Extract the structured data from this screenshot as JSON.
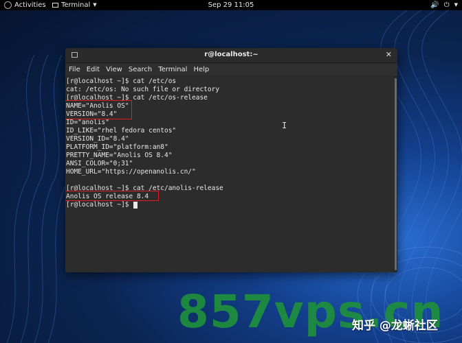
{
  "topbar": {
    "activities": "Activities",
    "app_name": "Terminal",
    "clock": "Sep 29  11:05",
    "tray_icons": [
      "speaker-icon",
      "power-icon",
      "chevron-down-icon"
    ]
  },
  "window": {
    "title": "r@localhost:~",
    "menu": [
      "File",
      "Edit",
      "View",
      "Search",
      "Terminal",
      "Help"
    ]
  },
  "terminal_lines": [
    "[r@localhost ~]$ cat /etc/os",
    "cat: /etc/os: No such file or directory",
    "[r@localhost ~]$ cat /etc/os-release",
    "NAME=\"Anolis OS\"",
    "VERSION=\"8.4\"",
    "ID=\"anolis\"",
    "ID_LIKE=\"rhel fedora centos\"",
    "VERSION_ID=\"8.4\"",
    "PLATFORM_ID=\"platform:an8\"",
    "PRETTY_NAME=\"Anolis OS 8.4\"",
    "ANSI_COLOR=\"0;31\"",
    "HOME_URL=\"https://openanolis.cn/\"",
    "",
    "[r@localhost ~]$ cat /etc/anolis-release",
    "Anolis OS release 8.4",
    "[r@localhost ~]$ "
  ],
  "colors": {
    "highlight": "#e02020",
    "watermark": "#1f8f3c"
  },
  "watermark": {
    "site": "857vps.cn",
    "source": "知乎 @龙蜥社区"
  }
}
